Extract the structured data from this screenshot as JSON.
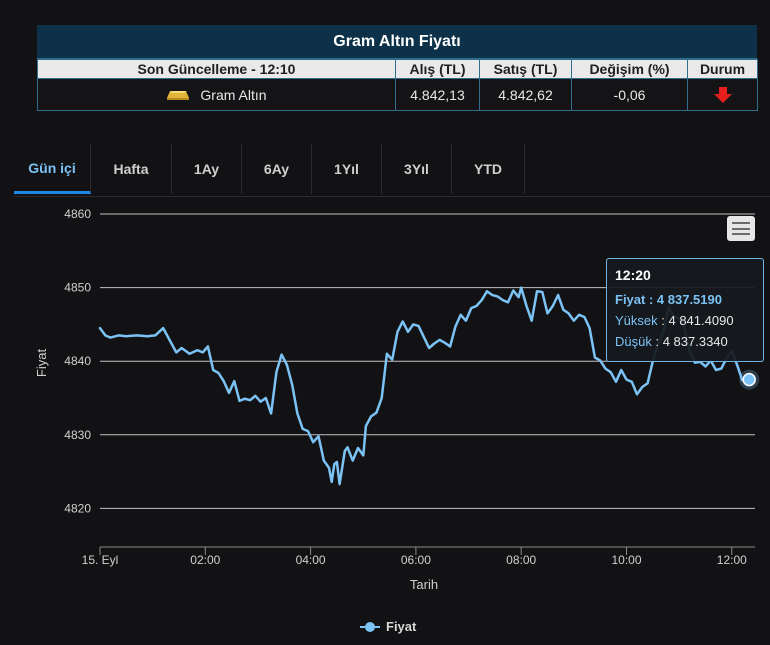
{
  "table": {
    "title": "Gram Altın Fiyatı",
    "headers": [
      "Son Güncelleme - 12:10",
      "Alış (TL)",
      "Satış (TL)",
      "Değişim (%)",
      "Durum"
    ],
    "row": {
      "name": "Gram Altın",
      "buy": "4.842,13",
      "sell": "4.842,62",
      "change": "-0,06",
      "status_icon": "down-arrow-icon",
      "status_color": "#e61e1e"
    }
  },
  "tabs": [
    "Gün içi",
    "Hafta",
    "1Ay",
    "6Ay",
    "1Yıl",
    "3Yıl",
    "YTD"
  ],
  "active_tab": "Gün içi",
  "tooltip": {
    "time": "12:20",
    "price_label": "Fiyat",
    "price_value": "4 837.5190",
    "high_label": "Yüksek",
    "high_value": "4 841.4090",
    "low_label": "Düşük",
    "low_value": "4 837.3340"
  },
  "chart_data": {
    "type": "line",
    "xlabel": "Tarih",
    "ylabel": "Fiyat",
    "ylim": [
      4815,
      4862
    ],
    "xlim": [
      0,
      12.42
    ],
    "yticks": [
      4820,
      4830,
      4840,
      4850,
      4860
    ],
    "xticks": [
      {
        "v": 0,
        "label": "15. Eyl"
      },
      {
        "v": 2,
        "label": "02:00"
      },
      {
        "v": 4,
        "label": "04:00"
      },
      {
        "v": 6,
        "label": "06:00"
      },
      {
        "v": 8,
        "label": "08:00"
      },
      {
        "v": 10,
        "label": "10:00"
      },
      {
        "v": 12,
        "label": "12:00"
      }
    ],
    "grid": true,
    "legend": "bottom-center",
    "color": "#7cc3f5",
    "series": [
      {
        "name": "Fiyat",
        "x": [
          0,
          0.1,
          0.2,
          0.35,
          0.5,
          0.7,
          0.9,
          1.05,
          1.2,
          1.35,
          1.45,
          1.55,
          1.7,
          1.85,
          1.95,
          2.05,
          2.15,
          2.25,
          2.35,
          2.45,
          2.55,
          2.65,
          2.75,
          2.85,
          2.95,
          3.05,
          3.15,
          3.25,
          3.35,
          3.45,
          3.55,
          3.65,
          3.75,
          3.85,
          3.95,
          4.05,
          4.15,
          4.2,
          4.25,
          4.3,
          4.35,
          4.4,
          4.45,
          4.5,
          4.55,
          4.65,
          4.7,
          4.8,
          4.9,
          5.0,
          5.05,
          5.15,
          5.25,
          5.35,
          5.45,
          5.55,
          5.65,
          5.75,
          5.85,
          5.95,
          6.05,
          6.15,
          6.25,
          6.35,
          6.45,
          6.55,
          6.65,
          6.75,
          6.85,
          6.95,
          7.05,
          7.15,
          7.25,
          7.35,
          7.45,
          7.55,
          7.65,
          7.75,
          7.85,
          7.95,
          8.0,
          8.1,
          8.2,
          8.3,
          8.4,
          8.5,
          8.6,
          8.7,
          8.8,
          8.9,
          9.0,
          9.1,
          9.2,
          9.3,
          9.4,
          9.5,
          9.6,
          9.7,
          9.8,
          9.9,
          10.0,
          10.1,
          10.2,
          10.3,
          10.4,
          10.5,
          10.6,
          10.7,
          10.8,
          10.9,
          11.0,
          11.1,
          11.2,
          11.3,
          11.4,
          11.5,
          11.6,
          11.7,
          11.8,
          11.9,
          12.0,
          12.1,
          12.2,
          12.33
        ],
        "values": [
          4844.5,
          4843.5,
          4843.2,
          4843.5,
          4843.4,
          4843.5,
          4843.4,
          4843.5,
          4844.5,
          4842.5,
          4841.2,
          4841.8,
          4841.0,
          4841.5,
          4841.2,
          4842.0,
          4838.8,
          4838.4,
          4837.3,
          4835.7,
          4837.3,
          4834.6,
          4834.9,
          4834.7,
          4835.3,
          4834.5,
          4835.0,
          4832.9,
          4838.5,
          4840.9,
          4839.5,
          4836.8,
          4832.9,
          4830.8,
          4830.5,
          4829.0,
          4829.8,
          4828.2,
          4826.5,
          4826.0,
          4825.5,
          4823.6,
          4826.0,
          4826.3,
          4823.3,
          4827.8,
          4828.3,
          4826.5,
          4828.2,
          4827.2,
          4831.2,
          4832.5,
          4833.0,
          4835.0,
          4841.0,
          4840.2,
          4844.0,
          4845.4,
          4844.0,
          4845.0,
          4844.8,
          4843.3,
          4841.8,
          4842.4,
          4842.9,
          4842.5,
          4842.0,
          4844.7,
          4846.3,
          4845.5,
          4847.2,
          4847.5,
          4848.3,
          4849.5,
          4849.0,
          4848.8,
          4848.3,
          4848.0,
          4849.6,
          4848.7,
          4850.0,
          4847.5,
          4845.5,
          4849.5,
          4849.4,
          4846.5,
          4847.5,
          4849.0,
          4847.0,
          4846.5,
          4845.5,
          4846.3,
          4846.0,
          4844.5,
          4840.5,
          4840.1,
          4839.0,
          4838.5,
          4837.2,
          4838.8,
          4837.5,
          4837.2,
          4835.5,
          4836.5,
          4837.0,
          4840.0,
          4842.3,
          4844.0,
          4847.3,
          4846.1,
          4845.8,
          4844.6,
          4841.4,
          4839.8,
          4839.9,
          4839.3,
          4840.1,
          4838.8,
          4839.0,
          4840.4,
          4841.4,
          4839.5,
          4837.4,
          4837.5
        ]
      }
    ]
  }
}
